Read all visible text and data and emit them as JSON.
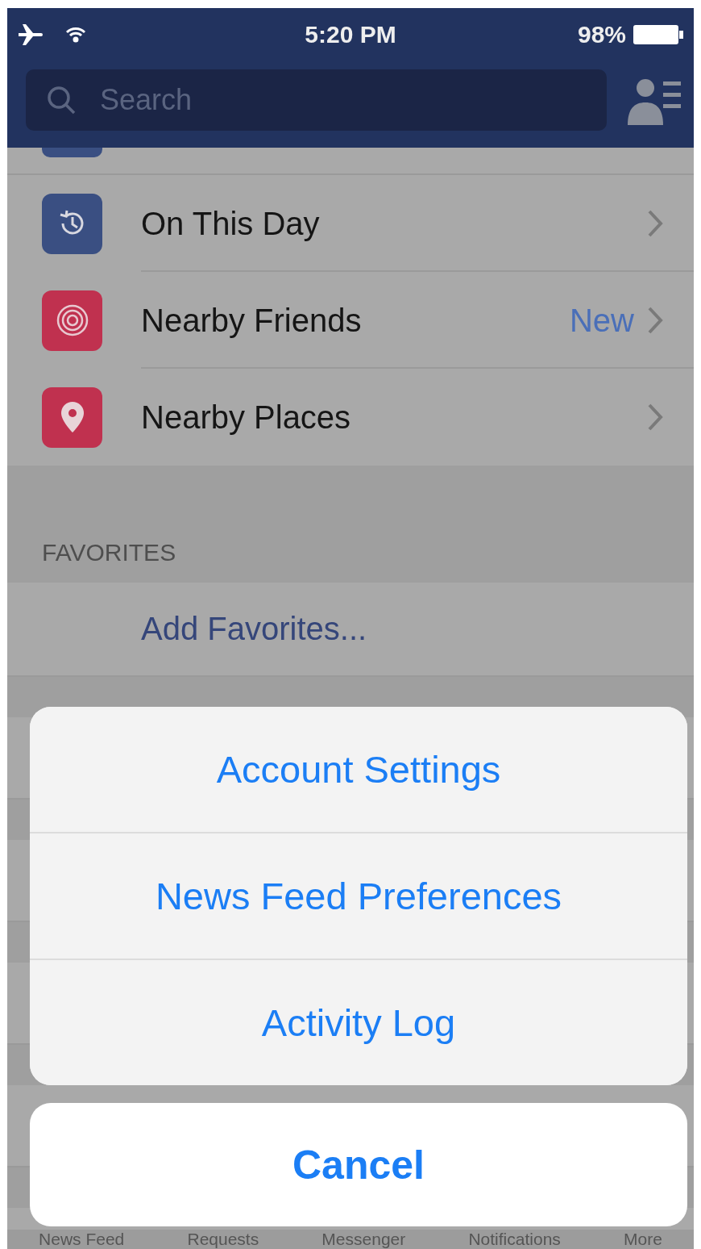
{
  "status_bar": {
    "time": "5:20 PM",
    "battery": "98%"
  },
  "search": {
    "placeholder": "Search"
  },
  "menu_items": [
    {
      "label": "On This Day",
      "kind": "history",
      "color": "#3a4f82"
    },
    {
      "label": "Nearby Friends",
      "kind": "target",
      "color": "#c0314f",
      "badge": "New"
    },
    {
      "label": "Nearby Places",
      "kind": "pin",
      "color": "#c0314f"
    }
  ],
  "favorites": {
    "header": "FAVORITES",
    "items": [
      "Add Favorites..."
    ]
  },
  "action_sheet": {
    "items": [
      "Account Settings",
      "News Feed Preferences",
      "Activity Log"
    ],
    "cancel": "Cancel"
  },
  "tab_bar": [
    "News Feed",
    "Requests",
    "Messenger",
    "Notifications",
    "More"
  ]
}
